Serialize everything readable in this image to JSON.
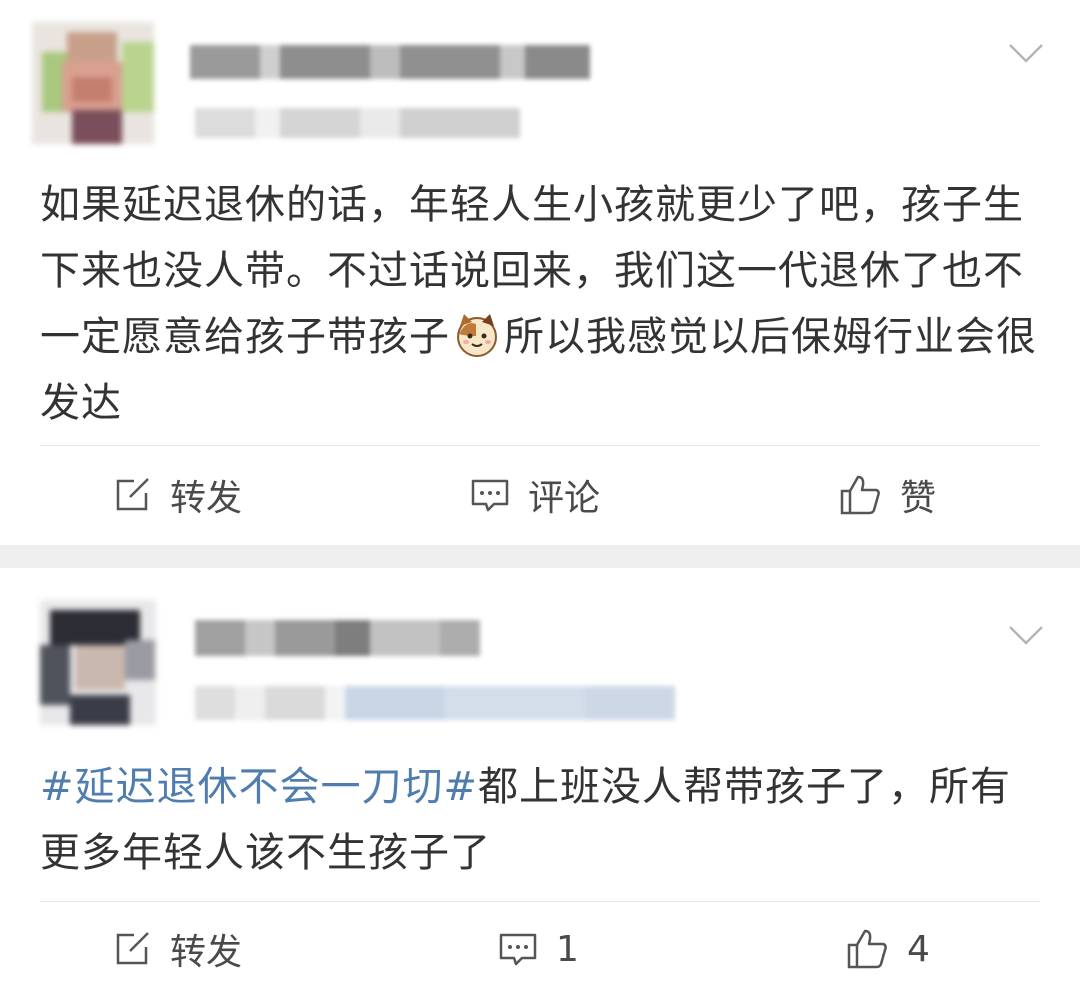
{
  "posts": [
    {
      "username": "",
      "meta": "",
      "text": "如果延迟退休的话，年轻人生小孩就更少了吧，孩子生下来也没人带。不过话说回来，我们这一代退休了也不一定愿意给孩子带孩子",
      "text_after_emoji": "所以我感觉以后保姆行业会很发达",
      "emoji": "cat-emoji",
      "actions": {
        "repost": "转发",
        "comment": "评论",
        "like": "赞"
      }
    },
    {
      "username": "",
      "meta": "",
      "topic": "#延迟退休不会一刀切#",
      "text": "都上班没人帮带孩子了，所有更多年轻人该不生孩子了",
      "actions": {
        "repost": "转发",
        "comment": "1",
        "like": "4"
      }
    }
  ],
  "colors": {
    "topic": "#507daf",
    "text": "#333333",
    "separator": "#efefef"
  }
}
